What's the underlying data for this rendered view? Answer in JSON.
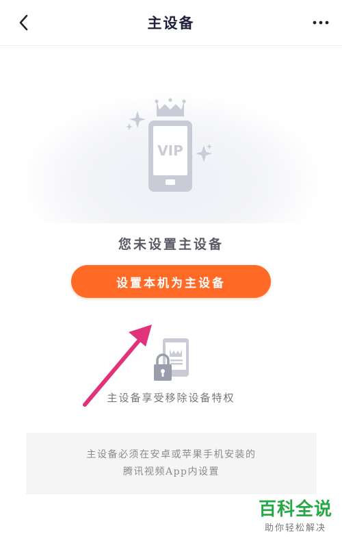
{
  "header": {
    "title": "主设备"
  },
  "hero": {
    "phone_text": "VIP"
  },
  "status": {
    "message": "您未设置主设备"
  },
  "actions": {
    "set_primary_label": "设置本机为主设备"
  },
  "privilege": {
    "text": "主设备享受移除设备特权"
  },
  "note": {
    "line1": "主设备必须在安卓或苹果手机安装的",
    "line2": "腾讯视频App内设置"
  },
  "watermark": {
    "main": "百科全说",
    "sub": "助你轻松解决"
  },
  "colors": {
    "accent": "#ff6a26",
    "annotation_arrow": "#e0337a",
    "watermark_green": "#27a845"
  }
}
